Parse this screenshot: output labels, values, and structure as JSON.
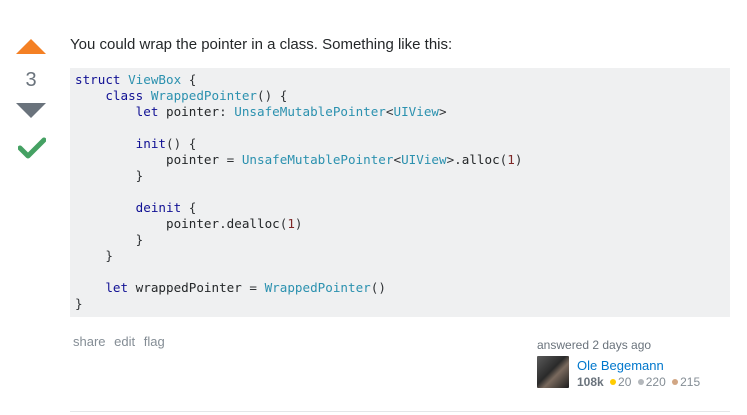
{
  "vote": {
    "count": "3"
  },
  "answer": {
    "text": "You could wrap the pointer in a class. Something like this:",
    "code_lines": [
      [
        {
          "t": "struct ",
          "c": "kw"
        },
        {
          "t": "ViewBox",
          "c": "typ"
        },
        {
          "t": " {",
          "c": "pun"
        }
      ],
      [
        {
          "t": "    class ",
          "c": "kw"
        },
        {
          "t": "WrappedPointer",
          "c": "typ"
        },
        {
          "t": "() {",
          "c": "pun"
        }
      ],
      [
        {
          "t": "        let ",
          "c": "kw"
        },
        {
          "t": "pointer",
          "c": ""
        },
        {
          "t": ": ",
          "c": "pun"
        },
        {
          "t": "UnsafeMutablePointer",
          "c": "typ"
        },
        {
          "t": "<",
          "c": "pun"
        },
        {
          "t": "UIView",
          "c": "typ"
        },
        {
          "t": ">",
          "c": "pun"
        }
      ],
      [],
      [
        {
          "t": "        init",
          "c": "kw"
        },
        {
          "t": "() {",
          "c": "pun"
        }
      ],
      [
        {
          "t": "            pointer ",
          "c": ""
        },
        {
          "t": "= ",
          "c": "pun"
        },
        {
          "t": "UnsafeMutablePointer",
          "c": "typ"
        },
        {
          "t": "<",
          "c": "pun"
        },
        {
          "t": "UIView",
          "c": "typ"
        },
        {
          "t": ">.",
          "c": "pun"
        },
        {
          "t": "alloc",
          "c": ""
        },
        {
          "t": "(",
          "c": "pun"
        },
        {
          "t": "1",
          "c": "lit"
        },
        {
          "t": ")",
          "c": "pun"
        }
      ],
      [
        {
          "t": "        }",
          "c": "pun"
        }
      ],
      [],
      [
        {
          "t": "        deinit ",
          "c": "kw"
        },
        {
          "t": "{",
          "c": "pun"
        }
      ],
      [
        {
          "t": "            pointer",
          "c": ""
        },
        {
          "t": ".",
          "c": "pun"
        },
        {
          "t": "dealloc",
          "c": ""
        },
        {
          "t": "(",
          "c": "pun"
        },
        {
          "t": "1",
          "c": "lit"
        },
        {
          "t": ")",
          "c": "pun"
        }
      ],
      [
        {
          "t": "        }",
          "c": "pun"
        }
      ],
      [
        {
          "t": "    }",
          "c": "pun"
        }
      ],
      [],
      [
        {
          "t": "    let ",
          "c": "kw"
        },
        {
          "t": "wrappedPointer ",
          "c": ""
        },
        {
          "t": "= ",
          "c": "pun"
        },
        {
          "t": "WrappedPointer",
          "c": "typ"
        },
        {
          "t": "()",
          "c": "pun"
        }
      ],
      [
        {
          "t": "}",
          "c": "pun"
        }
      ]
    ]
  },
  "menu": {
    "share": "share",
    "edit": "edit",
    "flag": "flag"
  },
  "user": {
    "action_time": "answered 2 days ago",
    "name": "Ole Begemann",
    "reputation": "108k",
    "gold": "20",
    "silver": "220",
    "bronze": "215"
  },
  "colors": {
    "upvote": "#f48024",
    "accepted": "#45a163",
    "gold": "#ffcc01",
    "silver": "#b4b8bc",
    "bronze": "#d1a684",
    "link": "#0077cc"
  },
  "icons": {
    "upvote": "triangle-up-icon",
    "downvote": "triangle-down-icon",
    "accepted": "checkmark-icon"
  }
}
